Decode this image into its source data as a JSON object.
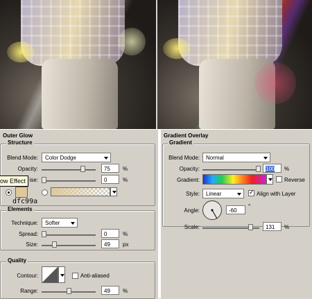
{
  "photos": {
    "left_alt": "photo-before",
    "right_alt": "photo-after"
  },
  "outer_glow": {
    "title": "Outer Glow",
    "structure": {
      "title": "Structure",
      "blend_mode_label": "Blend Mode:",
      "blend_mode_value": "Color Dodge",
      "opacity_label": "Opacity:",
      "opacity_value": "75",
      "opacity_unit": "%",
      "opacity_level": 0.75,
      "noise_label": "ise:",
      "noise_value": "0",
      "noise_unit": "%",
      "noise_level": 0.0,
      "glow_color": "#dfc99a",
      "tooltip": "ow Effect",
      "color_hex_label": "dfc99a"
    },
    "elements": {
      "title": "Elements",
      "technique_label": "Technique:",
      "technique_value": "Softer",
      "spread_label": "Spread:",
      "spread_value": "0",
      "spread_unit": "%",
      "spread_level": 0.0,
      "size_label": "Size:",
      "size_value": "49",
      "size_unit": "px",
      "size_level": 0.2
    },
    "quality": {
      "title": "Quality",
      "contour_label": "Contour:",
      "anti_aliased_label": "Anti-aliased",
      "anti_aliased_checked": false,
      "range_label": "Range:",
      "range_value": "49",
      "range_unit": "%",
      "range_level": 0.49
    }
  },
  "gradient_overlay": {
    "title": "Gradient Overlay",
    "gradient": {
      "title": "Gradient",
      "blend_mode_label": "Blend Mode:",
      "blend_mode_value": "Normal",
      "opacity_label": "Opacity:",
      "opacity_value": "100",
      "opacity_unit": "%",
      "opacity_level": 1.0,
      "gradient_label": "Gradient:",
      "reverse_label": "Reverse",
      "reverse_checked": false,
      "style_label": "Style:",
      "style_value": "Linear",
      "align_label": "Align with Layer",
      "align_checked": true,
      "angle_label": "Angle:",
      "angle_value": "-60",
      "angle_unit": "°",
      "scale_label": "Scale:",
      "scale_value": "131",
      "scale_unit": "%",
      "scale_level": 0.87
    }
  }
}
